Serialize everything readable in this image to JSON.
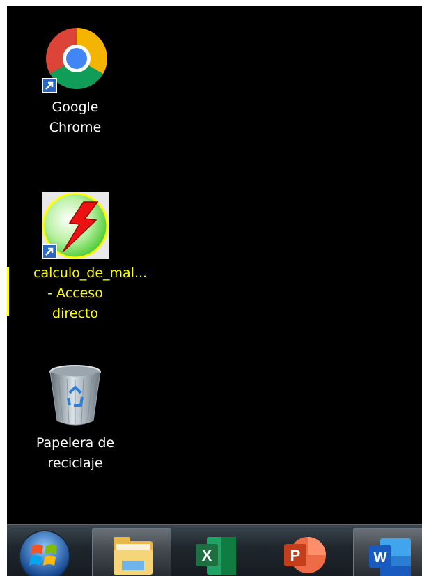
{
  "desktop": {
    "icons": [
      {
        "label_line1": "Google Chrome",
        "label_line2": "",
        "icon": "chrome-icon"
      },
      {
        "label_line1": "calculo_de_mal...",
        "label_line2": "- Acceso directo",
        "icon": "lightning-shortcut-icon",
        "selected": true
      },
      {
        "label_line1": "Papelera de",
        "label_line2": "reciclaje",
        "icon": "recycle-bin-icon"
      }
    ]
  },
  "taskbar": {
    "items": [
      {
        "name": "start-button",
        "icon": "windows-logo-icon"
      },
      {
        "name": "file-explorer",
        "icon": "folder-icon"
      },
      {
        "name": "excel",
        "icon": "excel-icon",
        "glyph": "X"
      },
      {
        "name": "powerpoint",
        "icon": "powerpoint-icon",
        "glyph": "P"
      },
      {
        "name": "word",
        "icon": "word-icon",
        "glyph": "W"
      }
    ]
  },
  "colors": {
    "desktop_bg": "#000000",
    "selection_text": "#ffff00",
    "excel": "#1d6f42",
    "powerpoint": "#d24726",
    "word": "#2b579a"
  }
}
